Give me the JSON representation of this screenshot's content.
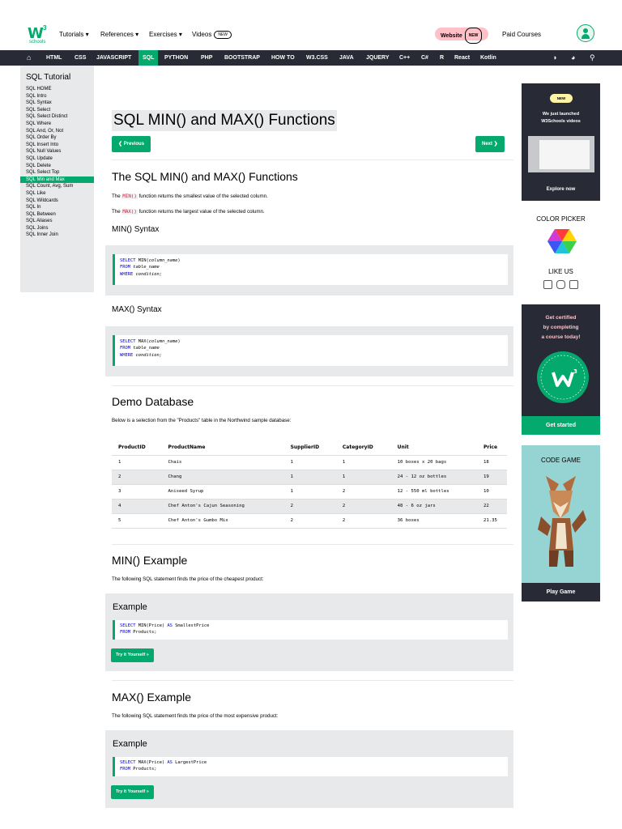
{
  "logo": {
    "mark": "W",
    "sup": "3",
    "sub": "schools"
  },
  "topnav": {
    "tutorials": "Tutorials ▾",
    "references": "References ▾",
    "exercises": "Exercises ▾",
    "videos": "Videos",
    "new_badge": "NEW",
    "website": "Website",
    "paid_courses": "Paid Courses"
  },
  "navbar": {
    "items": [
      "HTML",
      "CSS",
      "JAVASCRIPT",
      "SQL",
      "PYTHON",
      "PHP",
      "BOOTSTRAP",
      "HOW TO",
      "W3.CSS",
      "JAVA",
      "JQUERY",
      "C++",
      "C#",
      "R",
      "React",
      "Kotlin"
    ],
    "icons": [
      "◑",
      "◕",
      "⚲"
    ]
  },
  "sidebar": {
    "title": "SQL Tutorial",
    "items": [
      "SQL HOME",
      "SQL Intro",
      "SQL Syntax",
      "SQL Select",
      "SQL Select Distinct",
      "SQL Where",
      "SQL And, Or, Not",
      "SQL Order By",
      "SQL Insert Into",
      "SQL Null Values",
      "SQL Update",
      "SQL Delete",
      "SQL Select Top",
      "SQL Min and Max",
      "SQL Count, Avg, Sum",
      "SQL Like",
      "SQL Wildcards",
      "SQL In",
      "SQL Between",
      "SQL Aliases",
      "SQL Joins",
      "SQL Inner Join"
    ],
    "active_index": 13
  },
  "main": {
    "title": "SQL MIN() and MAX() Functions",
    "prev": "❮ Previous",
    "next": "Next ❯",
    "h2_functions": "The SQL MIN() and MAX() Functions",
    "p_min_pre": "The ",
    "p_min_kw": "MIN()",
    "p_min_post": " function returns the smallest value of the selected column.",
    "p_max_pre": "The ",
    "p_max_kw": "MAX()",
    "p_max_post": " function returns the largest value of the selected column.",
    "min_syntax_title": "MIN() Syntax",
    "min_syntax": {
      "l1a": "SELECT",
      "l1b": " MIN(",
      "l1c": "column_name",
      "l1d": ")",
      "l2a": "FROM",
      "l2b": " table_name",
      "l3a": "WHERE",
      "l3b": " condition;"
    },
    "max_syntax_title": "MAX() Syntax",
    "max_syntax": {
      "l1a": "SELECT",
      "l1b": " MAX(",
      "l1c": "column_name",
      "l1d": ")",
      "l2a": "FROM",
      "l2b": " table_name",
      "l3a": "WHERE",
      "l3b": " condition;"
    },
    "demo_title": "Demo Database",
    "demo_desc": "Below is a selection from the \"Products\" table in the Northwind sample database:",
    "table": {
      "headers": [
        "ProductID",
        "ProductName",
        "SupplierID",
        "CategoryID",
        "Unit",
        "Price"
      ],
      "rows": [
        [
          "1",
          "Chais",
          "1",
          "1",
          "10 boxes x 20 bags",
          "18"
        ],
        [
          "2",
          "Chang",
          "1",
          "1",
          "24 - 12 oz bottles",
          "19"
        ],
        [
          "3",
          "Aniseed Syrup",
          "1",
          "2",
          "12 - 550 ml bottles",
          "10"
        ],
        [
          "4",
          "Chef Anton's Cajun Seasoning",
          "2",
          "2",
          "48 - 6 oz jars",
          "22"
        ],
        [
          "5",
          "Chef Anton's Gumbo Mix",
          "2",
          "2",
          "36 boxes",
          "21.35"
        ]
      ]
    },
    "min_example_title": "MIN() Example",
    "min_example_desc": "The following SQL statement finds the price of the cheapest product:",
    "example_label": "Example",
    "min_code": {
      "l1a": "SELECT",
      "l1b": " MIN(Price) ",
      "l1c": "AS",
      "l1d": " SmallestPrice",
      "l2a": "FROM",
      "l2b": " Products;"
    },
    "try_it": "Try it Yourself »",
    "max_example_title": "MAX() Example",
    "max_example_desc": "The following SQL statement finds the price of the most expensive product:",
    "max_code": {
      "l1a": "SELECT",
      "l1b": " MAX(Price) ",
      "l1c": "AS",
      "l1d": " LargestPrice",
      "l2a": "FROM",
      "l2b": " Products;"
    }
  },
  "right": {
    "ad_new": "NEW",
    "ad_line1": "We just launched",
    "ad_line2": "W3Schools videos",
    "ad_cta": "Explore now",
    "color_picker": "COLOR PICKER",
    "like_us": "LIKE US",
    "cert_line1": "Get certified",
    "cert_line2": "by completing",
    "cert_line3": "a course today!",
    "cert_cta": "Get started",
    "game_title": "CODE GAME",
    "game_cta": "Play Game"
  },
  "colors": {
    "accent": "#04AA6D",
    "dark": "#282a35",
    "panel": "#e7e9eb",
    "pink": "#ffc0c7",
    "yellow": "#fff4a3"
  }
}
